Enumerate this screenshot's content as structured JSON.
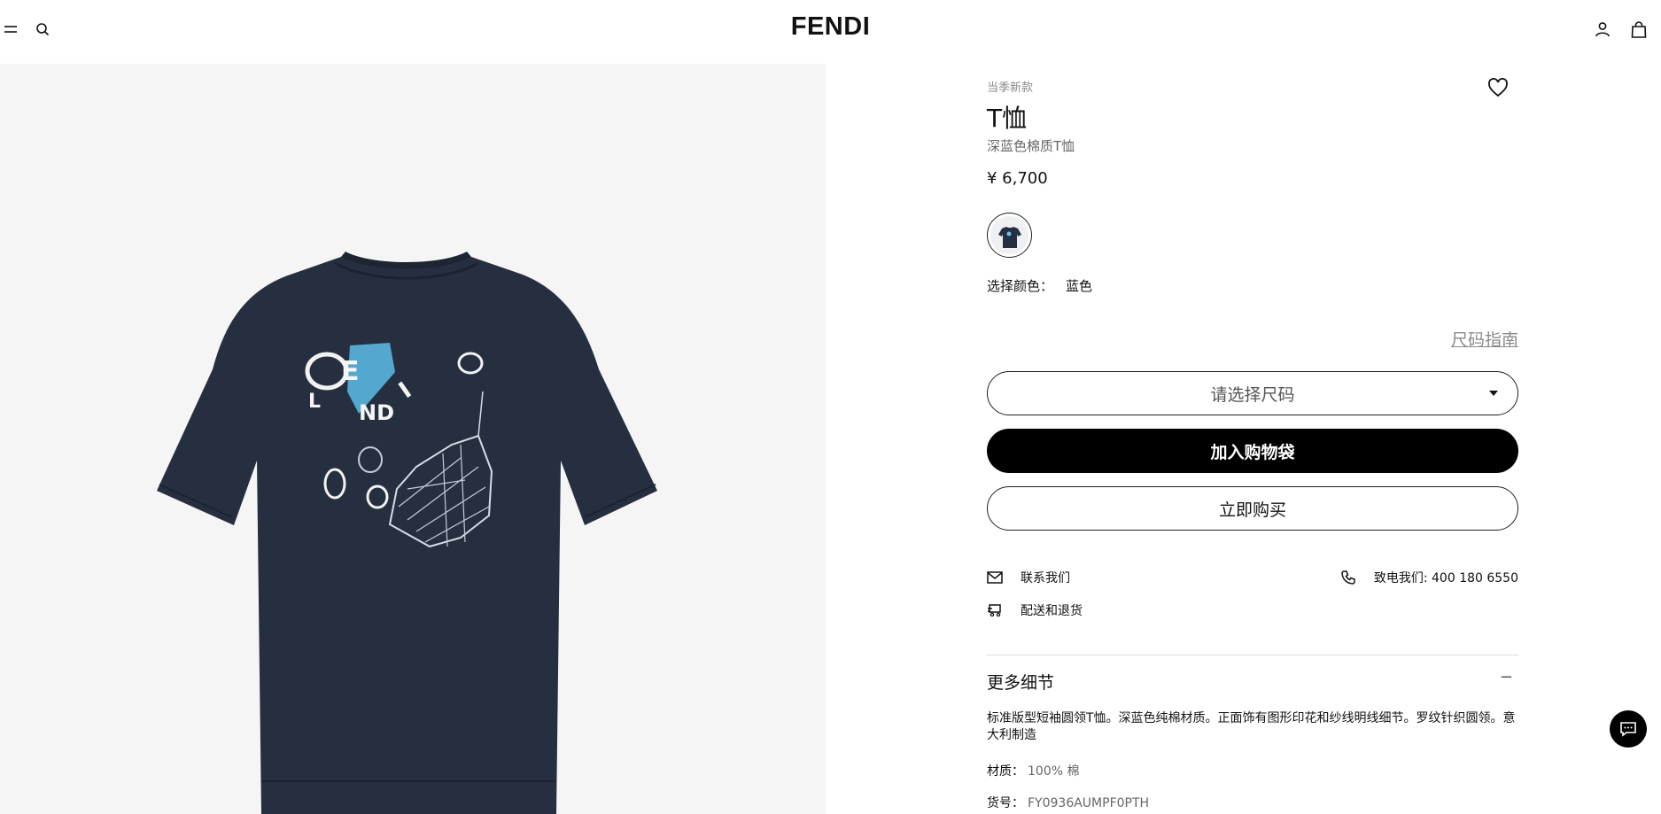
{
  "header": {
    "brand": "FENDI",
    "icons": [
      "menu-icon",
      "search-icon",
      "account-icon",
      "shopping-bag-icon"
    ]
  },
  "product": {
    "tag": "当季新款",
    "title": "T恤",
    "subtitle": "深蓝色棉质T恤",
    "price": "¥ 6,700",
    "color_label": "选择颜色：",
    "color_value": "蓝色",
    "size_guide": "尺码指南",
    "size_placeholder": "请选择尺码",
    "add_to_bag": "加入购物袋",
    "buy_now": "立即购买"
  },
  "service": {
    "contact": "联系我们",
    "phone": "致电我们: 400 180 6550",
    "shipping": "配送和退货"
  },
  "details": {
    "heading": "更多细节",
    "toggle": "−",
    "description": "标准版型短袖圆领T恤。深蓝色纯棉材质。正面饰有图形印花和纱线明线细节。罗纹针织圆领。意大利制造",
    "material_label": "材质：",
    "material_value": "100% 棉",
    "sku_label": "货号：",
    "sku_value": "FY0936AUMPF0PTH"
  },
  "colors": {
    "shirt": "#262f40",
    "accent": "#000000",
    "muted": "#8a8a8a"
  }
}
